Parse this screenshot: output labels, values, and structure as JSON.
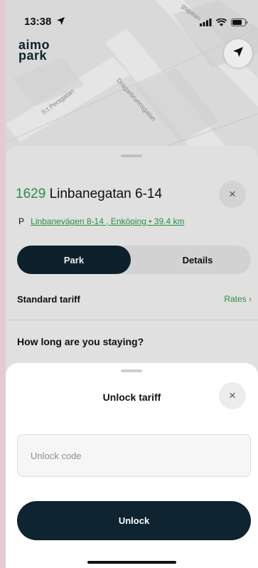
{
  "status_bar": {
    "time": "13:38"
  },
  "logo": {
    "line1": "aimo",
    "line2": "park"
  },
  "map": {
    "streets": [
      "S:t Persgatan",
      "Dragarbrunnsgatan",
      "gsgatan"
    ]
  },
  "lot": {
    "number": "1629",
    "name": "Linbanegatan 6-14",
    "parking_symbol": "P",
    "address": "Linbanevägen 8-14 , Enköping • 39.4 km"
  },
  "tabs": {
    "park": "Park",
    "details": "Details"
  },
  "tariff": {
    "label": "Standard tariff",
    "rates_link": "Rates ›"
  },
  "question": "How long are you staying?",
  "modal": {
    "title": "Unlock tariff",
    "close": "×",
    "input_placeholder": "Unlock code",
    "input_value": "",
    "button_label": "Unlock"
  },
  "sheet_close": "×",
  "colors": {
    "accent_green": "#2a9d4a",
    "primary_dark": "#0e2430"
  }
}
